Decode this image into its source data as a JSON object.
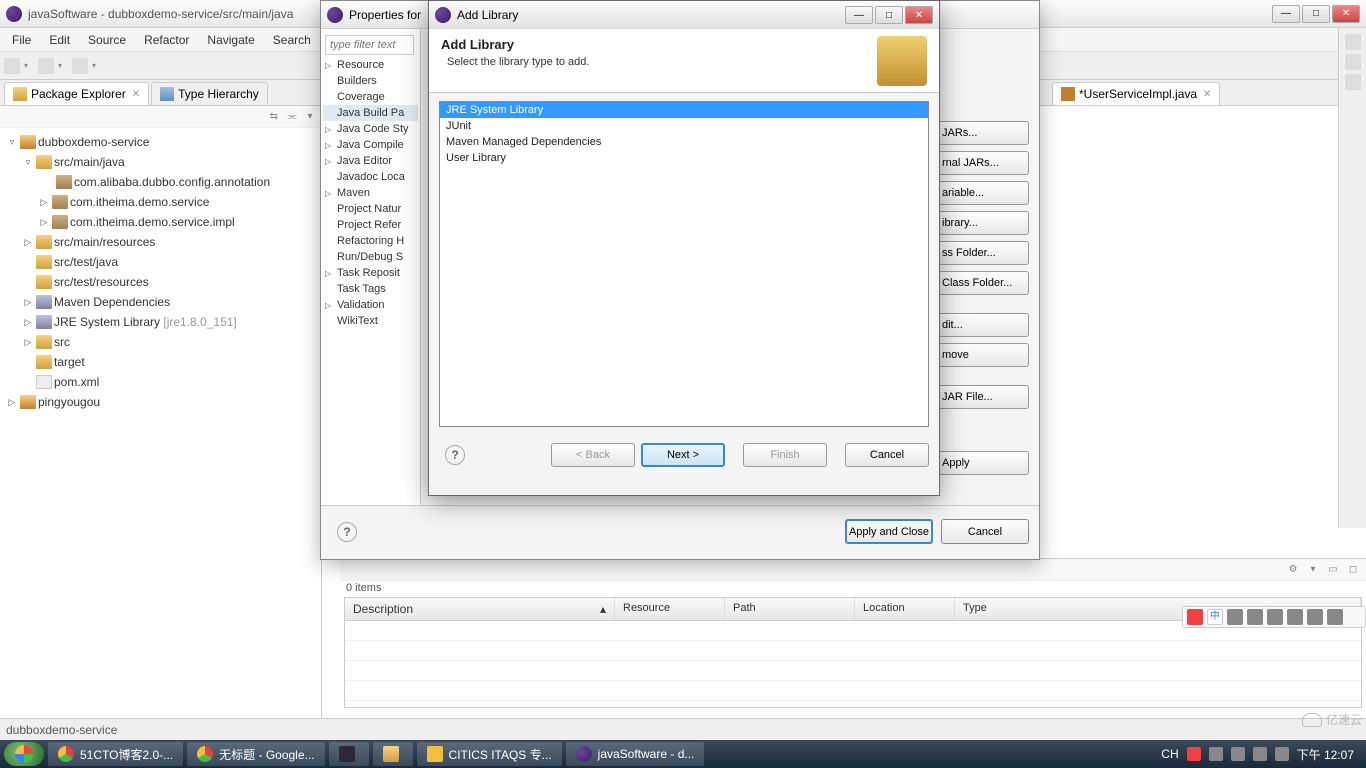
{
  "main_title": "javaSoftware - dubboxdemo-service/src/main/java",
  "menubar": [
    "File",
    "Edit",
    "Source",
    "Refactor",
    "Navigate",
    "Search"
  ],
  "left_tabs": {
    "active": "Package Explorer",
    "inactive": "Type Hierarchy"
  },
  "tree": {
    "proj1": "dubboxdemo-service",
    "src_main_java": "src/main/java",
    "pkg1": "com.alibaba.dubbo.config.annotation",
    "pkg2": "com.itheima.demo.service",
    "pkg3": "com.itheima.demo.service.impl",
    "src_main_res": "src/main/resources",
    "src_test_java": "src/test/java",
    "src_test_res": "src/test/resources",
    "maven_deps": "Maven Dependencies",
    "jre": "JRE System Library",
    "jre_ver": "[jre1.8.0_151]",
    "src": "src",
    "target": "target",
    "pom": "pom.xml",
    "proj2": "pingyougou"
  },
  "editor_tab": "*UserServiceImpl.java",
  "props_dialog": {
    "title": "Properties for",
    "filter_placeholder": "type filter text",
    "tree": [
      "Resource",
      "Builders",
      "Coverage",
      "Java Build Pa",
      "Java Code Sty",
      "Java Compile",
      "Java Editor",
      "Javadoc Loca",
      "Maven",
      "Project Natur",
      "Project Refer",
      "Refactoring H",
      "Run/Debug S",
      "Task Reposit",
      "Task Tags",
      "Validation",
      "WikiText"
    ],
    "side_btns": [
      "JARs...",
      "rnal JARs...",
      "ariable...",
      "ibrary...",
      "ss Folder...",
      "Class Folder...",
      "dit...",
      "move",
      "JAR File..."
    ],
    "apply": "Apply",
    "apply_close": "Apply and Close",
    "cancel": "Cancel"
  },
  "addlib_dialog": {
    "title": "Add Library",
    "heading": "Add Library",
    "subtitle": "Select the library type to add.",
    "items": [
      "JRE System Library",
      "JUnit",
      "Maven Managed Dependencies",
      "User Library"
    ],
    "back": "< Back",
    "next": "Next >",
    "finish": "Finish",
    "cancel": "Cancel"
  },
  "problems": {
    "count": "0 items",
    "cols": [
      "Description",
      "Resource",
      "Path",
      "Location",
      "Type"
    ]
  },
  "statusbar": "dubboxdemo-service",
  "taskbar": {
    "items": [
      "51CTO博客2.0-...",
      "无标题 - Google...",
      "",
      "",
      "CITICS ITAQS 专...",
      "javaSoftware - d..."
    ],
    "tray_lang": "CH",
    "time": "下午 12:07"
  },
  "watermark": "亿速云"
}
